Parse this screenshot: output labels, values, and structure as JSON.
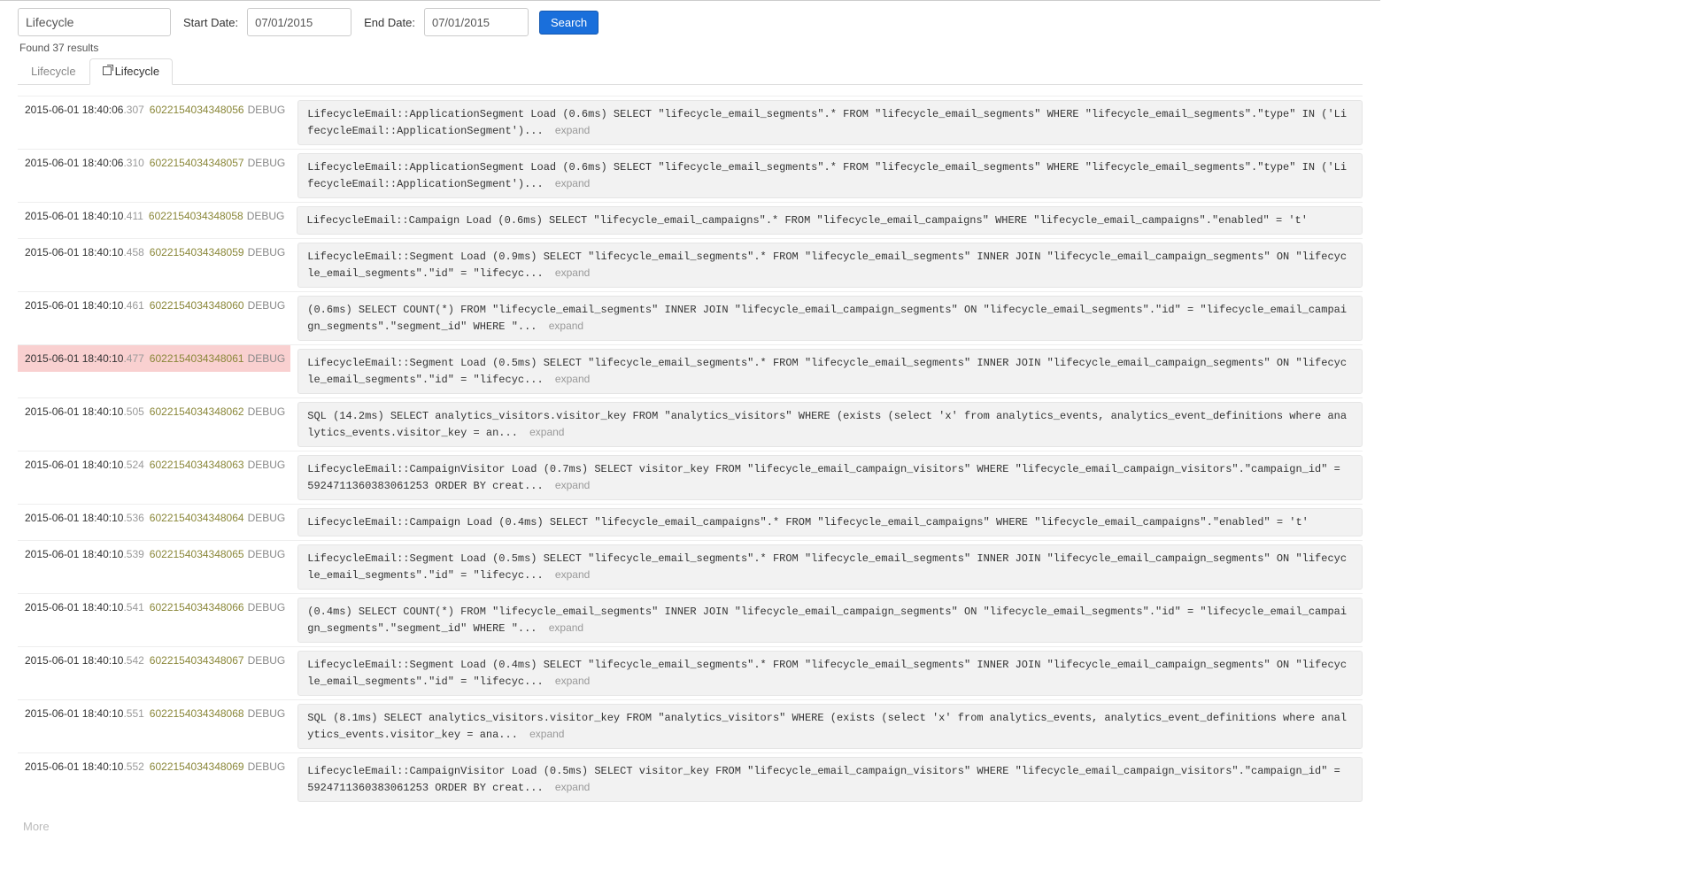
{
  "search": {
    "query": "Lifecycle",
    "start_label": "Start Date:",
    "start_value": "07/01/2015",
    "end_label": "End Date:",
    "end_value": "07/01/2015",
    "button": "Search"
  },
  "results_count": "Found 37 results",
  "tabs": {
    "inactive": "Lifecycle",
    "active": "Lifecycle"
  },
  "expand_label": "expand",
  "more_label": "More",
  "logs": [
    {
      "ts_main": "2015-06-01 18:40:06",
      "ts_ms": ".307",
      "seq": "6022154034348056",
      "level": "DEBUG",
      "highlight": false,
      "has_expand": true,
      "msg": "LifecycleEmail::ApplicationSegment Load (0.6ms) SELECT \"lifecycle_email_segments\".* FROM \"lifecycle_email_segments\" WHERE \"lifecycle_email_segments\".\"type\" IN ('LifecycleEmail::ApplicationSegment')..."
    },
    {
      "ts_main": "2015-06-01 18:40:06",
      "ts_ms": ".310",
      "seq": "6022154034348057",
      "level": "DEBUG",
      "highlight": false,
      "has_expand": true,
      "msg": "LifecycleEmail::ApplicationSegment Load (0.6ms) SELECT \"lifecycle_email_segments\".* FROM \"lifecycle_email_segments\" WHERE \"lifecycle_email_segments\".\"type\" IN ('LifecycleEmail::ApplicationSegment')..."
    },
    {
      "ts_main": "2015-06-01 18:40:10",
      "ts_ms": ".411",
      "seq": "6022154034348058",
      "level": "DEBUG",
      "highlight": false,
      "has_expand": false,
      "msg": "LifecycleEmail::Campaign Load (0.6ms) SELECT \"lifecycle_email_campaigns\".* FROM \"lifecycle_email_campaigns\" WHERE \"lifecycle_email_campaigns\".\"enabled\" = 't'"
    },
    {
      "ts_main": "2015-06-01 18:40:10",
      "ts_ms": ".458",
      "seq": "6022154034348059",
      "level": "DEBUG",
      "highlight": false,
      "has_expand": true,
      "msg": "LifecycleEmail::Segment Load (0.9ms) SELECT \"lifecycle_email_segments\".* FROM \"lifecycle_email_segments\" INNER JOIN \"lifecycle_email_campaign_segments\" ON \"lifecycle_email_segments\".\"id\" = \"lifecyc..."
    },
    {
      "ts_main": "2015-06-01 18:40:10",
      "ts_ms": ".461",
      "seq": "6022154034348060",
      "level": "DEBUG",
      "highlight": false,
      "has_expand": true,
      "msg": "(0.6ms) SELECT COUNT(*) FROM \"lifecycle_email_segments\" INNER JOIN \"lifecycle_email_campaign_segments\" ON \"lifecycle_email_segments\".\"id\" = \"lifecycle_email_campaign_segments\".\"segment_id\" WHERE \"..."
    },
    {
      "ts_main": "2015-06-01 18:40:10",
      "ts_ms": ".477",
      "seq": "6022154034348061",
      "level": "DEBUG",
      "highlight": true,
      "has_expand": true,
      "msg": "LifecycleEmail::Segment Load (0.5ms) SELECT \"lifecycle_email_segments\".* FROM \"lifecycle_email_segments\" INNER JOIN \"lifecycle_email_campaign_segments\" ON \"lifecycle_email_segments\".\"id\" = \"lifecyc..."
    },
    {
      "ts_main": "2015-06-01 18:40:10",
      "ts_ms": ".505",
      "seq": "6022154034348062",
      "level": "DEBUG",
      "highlight": false,
      "has_expand": true,
      "msg": "SQL (14.2ms) SELECT analytics_visitors.visitor_key FROM \"analytics_visitors\" WHERE (exists (select 'x' from analytics_events, analytics_event_definitions where analytics_events.visitor_key = an..."
    },
    {
      "ts_main": "2015-06-01 18:40:10",
      "ts_ms": ".524",
      "seq": "6022154034348063",
      "level": "DEBUG",
      "highlight": false,
      "has_expand": true,
      "msg": "LifecycleEmail::CampaignVisitor Load (0.7ms) SELECT visitor_key FROM \"lifecycle_email_campaign_visitors\" WHERE \"lifecycle_email_campaign_visitors\".\"campaign_id\" = 5924711360383061253 ORDER BY creat..."
    },
    {
      "ts_main": "2015-06-01 18:40:10",
      "ts_ms": ".536",
      "seq": "6022154034348064",
      "level": "DEBUG",
      "highlight": false,
      "has_expand": false,
      "msg": "LifecycleEmail::Campaign Load (0.4ms) SELECT \"lifecycle_email_campaigns\".* FROM \"lifecycle_email_campaigns\" WHERE \"lifecycle_email_campaigns\".\"enabled\" = 't'"
    },
    {
      "ts_main": "2015-06-01 18:40:10",
      "ts_ms": ".539",
      "seq": "6022154034348065",
      "level": "DEBUG",
      "highlight": false,
      "has_expand": true,
      "msg": "LifecycleEmail::Segment Load (0.5ms) SELECT \"lifecycle_email_segments\".* FROM \"lifecycle_email_segments\" INNER JOIN \"lifecycle_email_campaign_segments\" ON \"lifecycle_email_segments\".\"id\" = \"lifecyc..."
    },
    {
      "ts_main": "2015-06-01 18:40:10",
      "ts_ms": ".541",
      "seq": "6022154034348066",
      "level": "DEBUG",
      "highlight": false,
      "has_expand": true,
      "msg": "(0.4ms) SELECT COUNT(*) FROM \"lifecycle_email_segments\" INNER JOIN \"lifecycle_email_campaign_segments\" ON \"lifecycle_email_segments\".\"id\" = \"lifecycle_email_campaign_segments\".\"segment_id\" WHERE \"..."
    },
    {
      "ts_main": "2015-06-01 18:40:10",
      "ts_ms": ".542",
      "seq": "6022154034348067",
      "level": "DEBUG",
      "highlight": false,
      "has_expand": true,
      "msg": "LifecycleEmail::Segment Load (0.4ms) SELECT \"lifecycle_email_segments\".* FROM \"lifecycle_email_segments\" INNER JOIN \"lifecycle_email_campaign_segments\" ON \"lifecycle_email_segments\".\"id\" = \"lifecyc..."
    },
    {
      "ts_main": "2015-06-01 18:40:10",
      "ts_ms": ".551",
      "seq": "6022154034348068",
      "level": "DEBUG",
      "highlight": false,
      "has_expand": true,
      "msg": "SQL (8.1ms) SELECT analytics_visitors.visitor_key FROM \"analytics_visitors\" WHERE (exists (select 'x' from analytics_events, analytics_event_definitions where analytics_events.visitor_key = ana..."
    },
    {
      "ts_main": "2015-06-01 18:40:10",
      "ts_ms": ".552",
      "seq": "6022154034348069",
      "level": "DEBUG",
      "highlight": false,
      "has_expand": true,
      "msg": "LifecycleEmail::CampaignVisitor Load (0.5ms) SELECT visitor_key FROM \"lifecycle_email_campaign_visitors\" WHERE \"lifecycle_email_campaign_visitors\".\"campaign_id\" = 5924711360383061253 ORDER BY creat..."
    }
  ]
}
